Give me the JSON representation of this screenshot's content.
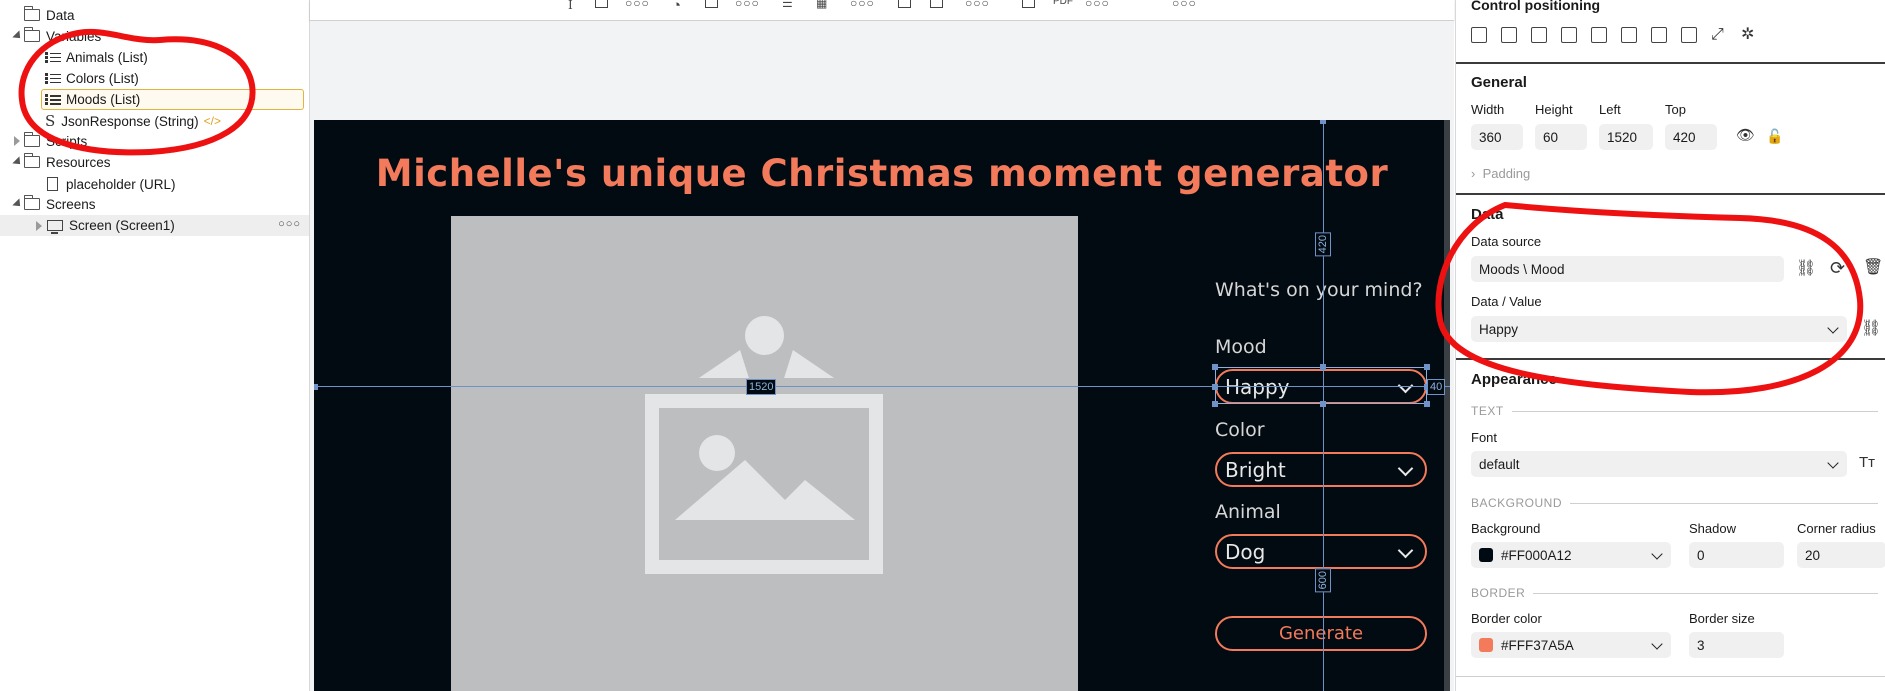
{
  "tree": {
    "items": [
      {
        "label": "Data"
      },
      {
        "label": "Variables"
      },
      {
        "label": "Animals (List)"
      },
      {
        "label": "Colors (List)"
      },
      {
        "label": "Moods (List)"
      },
      {
        "label": "JsonResponse (String)"
      },
      {
        "label": "Scripts"
      },
      {
        "label": "Resources"
      },
      {
        "label": "placeholder (URL)"
      },
      {
        "label": "Screens"
      },
      {
        "label": "Screen (Screen1)"
      }
    ],
    "row_menu": "○○○"
  },
  "canvas": {
    "app_title": "Michelle's unique Christmas moment generator",
    "prompt": "What's on your mind?",
    "mood_label": "Mood",
    "mood_value": "Happy",
    "color_label": "Color",
    "color_value": "Bright",
    "animal_label": "Animal",
    "animal_value": "Dog",
    "generate_label": "Generate",
    "dim_left": "1520",
    "dim_top": "420",
    "dim_right": "40",
    "dim_bottom": "600"
  },
  "props": {
    "control_positioning": "Control positioning",
    "general": {
      "title": "General",
      "width_label": "Width",
      "width": "360",
      "height_label": "Height",
      "height": "60",
      "left_label": "Left",
      "left": "1520",
      "top_label": "Top",
      "top": "420",
      "padding_label": "Padding"
    },
    "data": {
      "title": "Data",
      "source_label": "Data source",
      "source_value": "Moods \\ Mood",
      "value_label": "Data / Value",
      "value": "Happy"
    },
    "appearance": {
      "title": "Appearance",
      "text_group": "TEXT",
      "font_label": "Font",
      "font_value": "default",
      "background_group": "BACKGROUND",
      "background_label": "Background",
      "background_value": "#FF000A12",
      "shadow_label": "Shadow",
      "shadow_value": "0",
      "corner_label": "Corner radius",
      "corner_value": "20",
      "border_group": "BORDER",
      "border_color_label": "Border color",
      "border_color_value": "#FFF37A5A",
      "border_size_label": "Border size",
      "border_size_value": "3"
    }
  },
  "colors": {
    "accent": "#f37a5a",
    "screen_bg": "#020b12",
    "annotation": "#ee1111",
    "selection": "#e3b341"
  }
}
